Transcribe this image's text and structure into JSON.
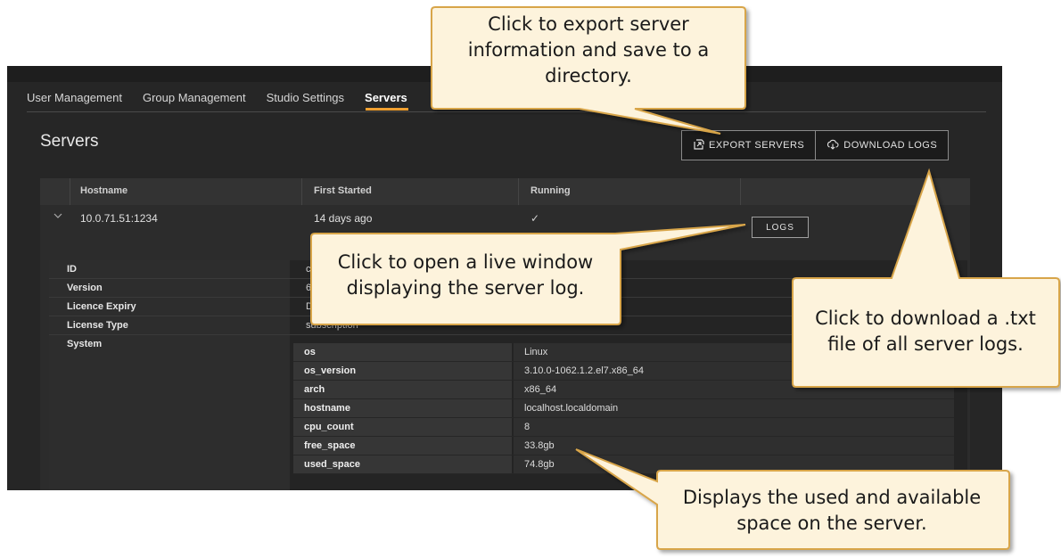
{
  "tabs": [
    {
      "label": "User Management"
    },
    {
      "label": "Group Management"
    },
    {
      "label": "Studio Settings"
    },
    {
      "label": "Servers"
    }
  ],
  "page_title": "Servers",
  "toolbar": {
    "export_label": "EXPORT SERVERS",
    "download_label": "DOWNLOAD LOGS"
  },
  "table": {
    "headers": [
      "Hostname",
      "First Started",
      "Running"
    ],
    "row": {
      "hostname": "10.0.71.51:1234",
      "first_started": "14 days ago",
      "running": "✓",
      "logs_label": "LOGS"
    }
  },
  "details": [
    {
      "key": "ID",
      "value": "cfc5"
    },
    {
      "key": "Version",
      "value": "6.2.("
    },
    {
      "key": "Licence Expiry",
      "value": "Dec"
    },
    {
      "key": "License Type",
      "value": "subscription"
    },
    {
      "key": "System",
      "value": ""
    }
  ],
  "system": [
    {
      "key": "os",
      "value": "Linux"
    },
    {
      "key": "os_version",
      "value": "3.10.0-1062.1.2.el7.x86_64"
    },
    {
      "key": "arch",
      "value": "x86_64"
    },
    {
      "key": "hostname",
      "value": "localhost.localdomain"
    },
    {
      "key": "cpu_count",
      "value": "8"
    },
    {
      "key": "free_space",
      "value": "33.8gb"
    },
    {
      "key": "used_space",
      "value": "74.8gb"
    }
  ],
  "callouts": {
    "export": [
      "Click to export server",
      "information and save to a",
      "directory."
    ],
    "logs": [
      "Click to open a live window",
      "displaying the server log."
    ],
    "download": [
      "Click to download a .txt",
      "file of all server logs."
    ],
    "space": [
      "Displays the used and available",
      "space on the server."
    ]
  },
  "colors": {
    "accent": "#f0a030",
    "callout_fill": "#fdf3dc",
    "callout_border": "#d8a54a",
    "app_bg": "#262626"
  }
}
